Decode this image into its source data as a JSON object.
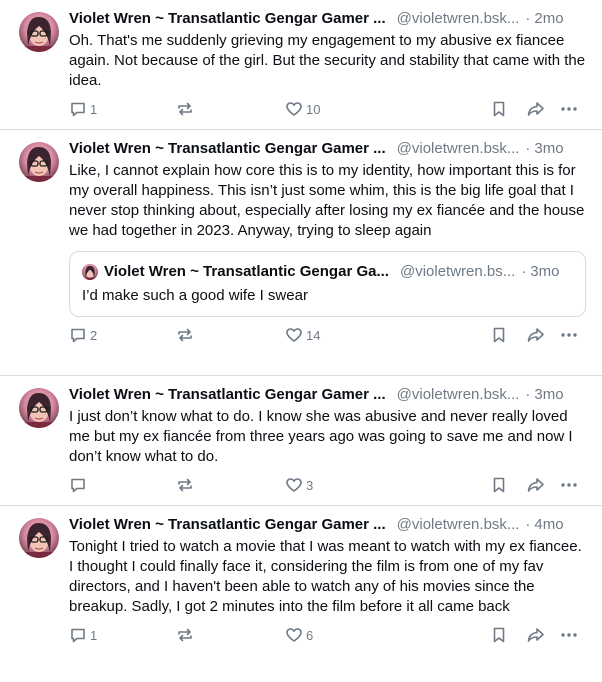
{
  "posts": [
    {
      "author": "Violet Wren ~ Transatlantic Gengar Gamer ...",
      "handle": "@violetwren.bsk...",
      "separator": "·",
      "time": "2mo",
      "text": "Oh. That's me suddenly grieving my engagement to my abusive ex fiancee again. Not because of the girl. But the security and stability that came with the idea.",
      "replies": "1",
      "reposts": "",
      "likes": "10"
    },
    {
      "author": "Violet Wren ~ Transatlantic Gengar Gamer ...",
      "handle": "@violetwren.bsk...",
      "separator": "·",
      "time": "3mo",
      "text": "Like, I cannot explain how core this is to my identity, how important this is for my overall happiness. This isn’t just some whim, this is the big life goal that I never stop thinking about, especially after losing my ex fiancée and the house we had together in 2023. Anyway, trying to sleep again",
      "quote": {
        "author": "Violet Wren ~ Transatlantic Gengar Ga...",
        "handle": "@violetwren.bs...",
        "separator": "·",
        "time": "3mo",
        "text": "I’d make such a good wife I swear"
      },
      "replies": "2",
      "reposts": "",
      "likes": "14"
    },
    {
      "author": "Violet Wren ~ Transatlantic Gengar Gamer ...",
      "handle": "@violetwren.bsk...",
      "separator": "·",
      "time": "3mo",
      "text": "I just don’t know what to do. I know she was abusive and never really loved me but my ex fiancée from three years ago was going to save me and now I don’t know what to do.",
      "replies": "",
      "reposts": "",
      "likes": "3"
    },
    {
      "author": "Violet Wren ~ Transatlantic Gengar Gamer ...",
      "handle": "@violetwren.bsk...",
      "separator": "·",
      "time": "4mo",
      "text": "Tonight I tried to watch a movie that I was meant to watch with my ex fiancee. I thought I could finally face it, considering the film is from one of my fav directors, and I haven't been able to watch any of his movies since the breakup. Sadly, I got 2 minutes into the film before it all came back",
      "replies": "1",
      "reposts": "",
      "likes": "6"
    }
  ],
  "icons": {
    "reply": "speech-bubble-icon",
    "repost": "repost-arrows-icon",
    "like": "heart-icon",
    "bookmark": "bookmark-icon",
    "share": "share-arrow-icon",
    "more": "ellipsis-icon"
  },
  "colors": {
    "text": "#0b0f14",
    "muted": "#6f7a86",
    "divider": "#d4dbe2"
  }
}
